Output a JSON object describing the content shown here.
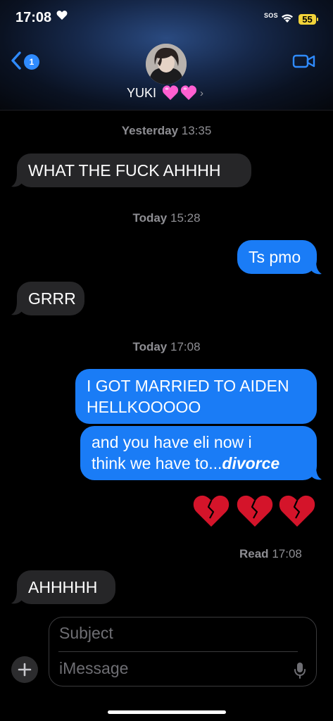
{
  "status": {
    "time": "17:08",
    "sos": "SOS",
    "battery": "55"
  },
  "header": {
    "back_badge": "1",
    "contact_name": "YUKI"
  },
  "thread": [
    {
      "type": "stamp",
      "day": "Yesterday",
      "time": "13:35"
    },
    {
      "type": "msg",
      "from": "them",
      "text": "WHAT THE FUCK AHHHH"
    },
    {
      "type": "stamp",
      "day": "Today",
      "time": "15:28"
    },
    {
      "type": "msg",
      "from": "me",
      "text": "Ts pmo"
    },
    {
      "type": "msg",
      "from": "them",
      "text": "GRRR"
    },
    {
      "type": "stamp",
      "day": "Today",
      "time": "17:08"
    },
    {
      "type": "msg",
      "from": "me",
      "lines": [
        "I GOT MARRIED TO AIDEN",
        "HELLKOOOOO"
      ]
    },
    {
      "type": "msg",
      "from": "me",
      "lines": [
        "and you have eli now i",
        "think we have to..."
      ],
      "emphasis": "divorce"
    },
    {
      "type": "emoji",
      "from": "me",
      "emojis": [
        "broken-heart",
        "broken-heart",
        "broken-heart"
      ]
    },
    {
      "type": "receipt",
      "label": "Read",
      "time": "17:08"
    },
    {
      "type": "msg",
      "from": "them",
      "text": "AHHHHH"
    }
  ],
  "composer": {
    "subject_placeholder": "Subject",
    "message_placeholder": "iMessage"
  },
  "colors": {
    "sent_bubble": "#1a7cf6",
    "received_bubble": "#262628",
    "accent": "#2f8bff",
    "battery": "#f2d33a",
    "heart": "#ff5fd2",
    "broken_heart": "#d4142a"
  },
  "icons": [
    "heart-icon",
    "wifi-icon",
    "battery-icon",
    "back-chevron-icon",
    "video-camera-icon",
    "pink-heart-icon",
    "broken-heart-icon",
    "plus-icon",
    "microphone-icon"
  ]
}
